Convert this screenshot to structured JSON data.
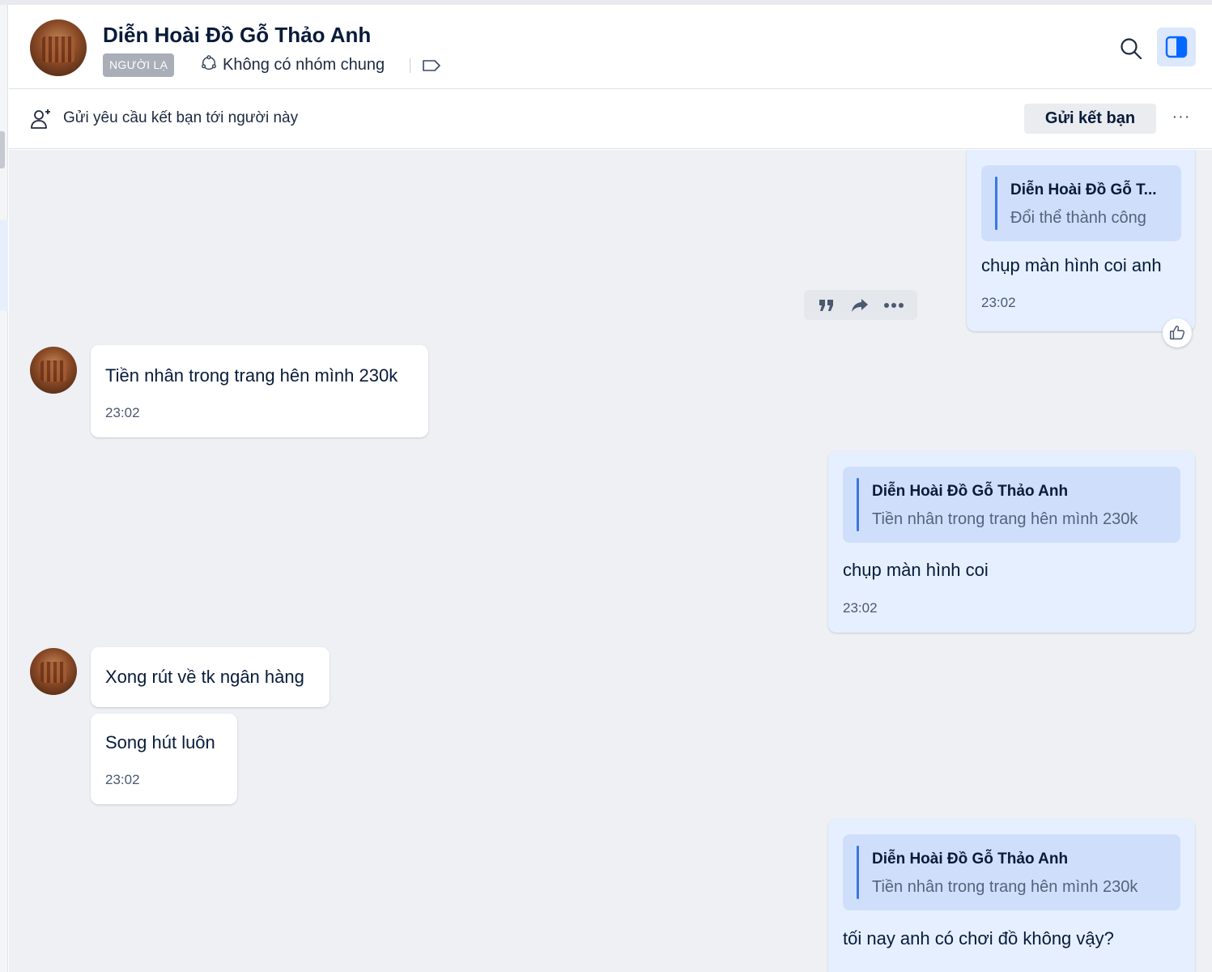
{
  "header": {
    "contact_name": "Diễn Hoài Đồ Gỗ Thảo Anh",
    "stranger_badge": "NGƯỜI LẠ",
    "common_groups": "Không có nhóm chung",
    "icons": [
      "group-icon",
      "tag-icon",
      "search-icon",
      "sidebar-panel-icon"
    ]
  },
  "friend_request": {
    "text": "Gửi yêu cầu kết bạn tới người này",
    "button": "Gửi kết bạn",
    "more": "···"
  },
  "messages": [
    {
      "direction": "out",
      "quote_name": "Diễn Hoài Đồ Gỗ T...",
      "quote_text": "Đổi thể thành công",
      "text": "chụp màn hình coi anh",
      "time": "23:02"
    },
    {
      "direction": "in",
      "text": "Tiền nhân trong trang hên mình 230k",
      "time": "23:02"
    },
    {
      "direction": "out",
      "quote_name": "Diễn Hoài Đồ Gỗ Thảo Anh",
      "quote_text": "Tiền nhân trong trang hên mình 230k",
      "text": "chụp màn hình coi",
      "time": "23:02"
    },
    {
      "direction": "in",
      "text": "Xong rút về tk ngân hàng"
    },
    {
      "direction": "in",
      "text": "Song hút luôn",
      "time": "23:02"
    },
    {
      "direction": "out",
      "quote_name": "Diễn Hoài Đồ Gỗ Thảo Anh",
      "quote_text": "Tiền nhân trong trang hên mình 230k",
      "text": "tối nay anh có chơi đồ không vậy?"
    }
  ],
  "colors": {
    "outgoing_bubble": "#e5efff",
    "incoming_bubble": "#ffffff",
    "quote_background": "#cfdffb",
    "quote_bar": "#3b78e0",
    "chat_background": "#eef0f3",
    "accent": "#0068ff"
  }
}
